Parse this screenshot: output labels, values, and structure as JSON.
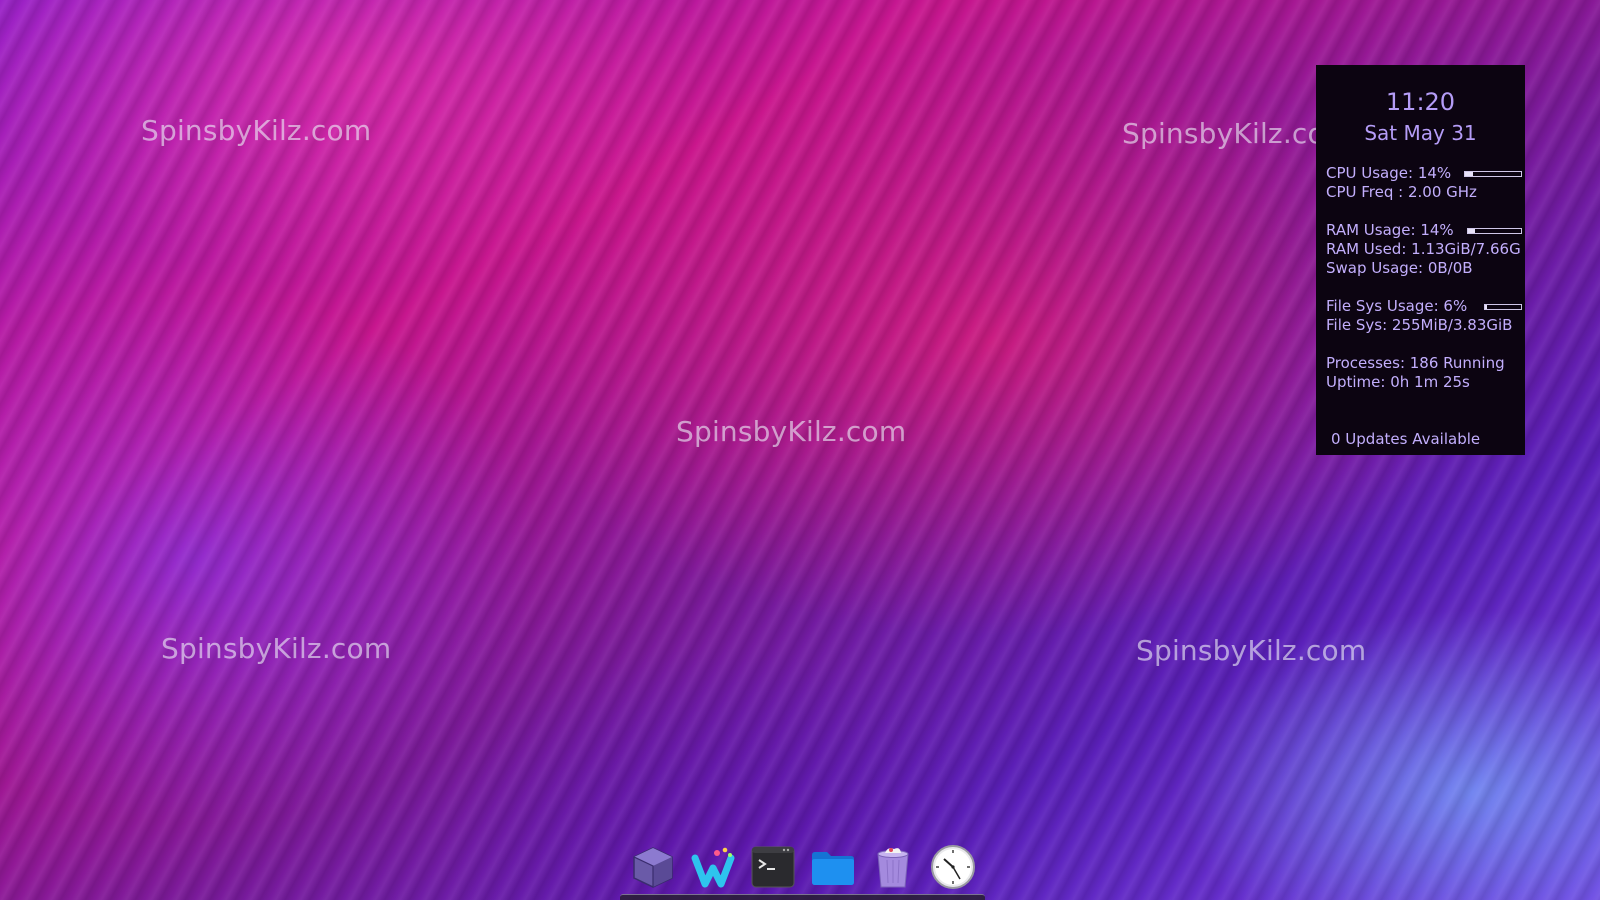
{
  "watermarks": [
    "SpinsbyKilz.com",
    "SpinsbyKilz.com",
    "SpinsbyKilz.com",
    "SpinsbyKilz.com",
    "SpinsbyKilz.com"
  ],
  "conky": {
    "time": "11:20",
    "date": "Sat May 31",
    "cpu_usage": "CPU Usage: 14%",
    "cpu_usage_pct": 14,
    "cpu_freq": "CPU Freq : 2.00 GHz",
    "ram_usage": "RAM Usage: 14%",
    "ram_usage_pct": 14,
    "ram_used": "RAM Used: 1.13GiB/7.66G",
    "swap_usage": "Swap Usage: 0B/0B",
    "fs_usage": "File Sys Usage:  6%",
    "fs_usage_pct": 6,
    "fs": "File Sys: 255MiB/3.83GiB",
    "processes": "Processes: 186   Running",
    "uptime": "Uptime: 0h 1m 25s",
    "updates": "0 Updates Available"
  },
  "dock": {
    "items": [
      {
        "icon": "cube-icon"
      },
      {
        "icon": "wayland-icon"
      },
      {
        "icon": "terminal-icon"
      },
      {
        "icon": "folder-icon"
      },
      {
        "icon": "trash-icon"
      },
      {
        "icon": "clock-icon"
      }
    ]
  },
  "colors": {
    "conky_text": "#c2aefc",
    "conky_bg": "#0c0411",
    "folder_blue": "#1e90f0"
  }
}
